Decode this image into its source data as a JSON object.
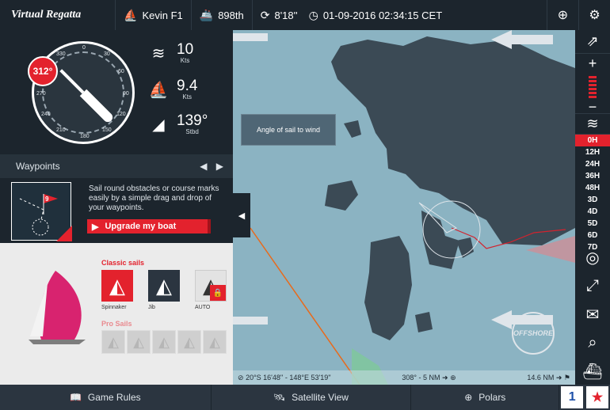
{
  "topbar": {
    "logo": "Virtual Regatta",
    "boat_name": "Kevin F1",
    "rank": "898th",
    "refresh_time": "8'18''",
    "datetime": "01-09-2016 02:34:15 CET"
  },
  "instruments": {
    "heading": "312°",
    "compass_labels": [
      "0",
      "30",
      "60",
      "90",
      "120",
      "150",
      "180",
      "210",
      "240",
      "270",
      "300",
      "330"
    ],
    "wind_speed": "10",
    "wind_unit": "Kts",
    "boat_speed": "9.4",
    "boat_unit": "Kts",
    "sail_angle": "139°",
    "sail_angle_side": "Stbd"
  },
  "waypoints": {
    "title": "Waypoints",
    "description": "Sail round obstacles or course marks easily by a simple drag and drop of your waypoints.",
    "upgrade_label": "Upgrade my boat",
    "thumb_number": "9"
  },
  "sails": {
    "classic_title": "Classic sails",
    "classic": [
      {
        "name": "Spinnaker",
        "color": "#e3222d"
      },
      {
        "name": "Jib",
        "color": "#2b3540"
      },
      {
        "name": "AUTO",
        "color": "#e3e3e3"
      }
    ],
    "pro_title": "Pro Sails"
  },
  "map": {
    "tooltip": "Angle of sail to wind",
    "position": "20°S 16'48'' - 148°E 53'19''",
    "bearing": "308° - 5 NM",
    "distance": "14.6 NM",
    "offshore_label": "OFFSHORE"
  },
  "rightbar": {
    "time_options": [
      "0H",
      "12H",
      "24H",
      "36H",
      "48H",
      "3D",
      "4D",
      "5D",
      "6D",
      "7D"
    ],
    "active_time": "0H"
  },
  "bottombar": {
    "game_rules": "Game Rules",
    "satellite_view": "Satellite View",
    "polars": "Polars",
    "vsr_label": "1"
  },
  "colors": {
    "accent": "#e3222d",
    "panel": "#1c252d",
    "sea": "#8bb3c2",
    "land": "#3b4a55"
  }
}
